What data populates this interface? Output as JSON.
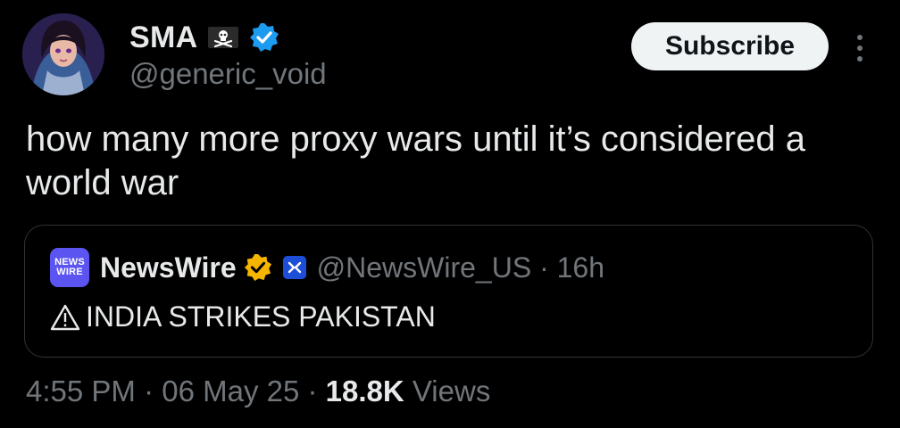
{
  "author": {
    "display_name": "SMA",
    "handle": "@generic_void",
    "avatar_icon": "anime-portrait-avatar",
    "flag_icon": "pirate-flag-icon",
    "badge_icon": "blue-verified-icon"
  },
  "actions": {
    "subscribe_label": "Subscribe",
    "more_icon": "more-options-icon"
  },
  "tweet": {
    "text": "how many more proxy wars until it’s considered a world war"
  },
  "quote": {
    "logo_line1": "NEWS",
    "logo_line2": "WIRE",
    "name": "NewsWire",
    "handle_time": "@NewsWire_US · 16h",
    "text": "INDIA STRIKES PAKISTAN",
    "warning_icon": "warning-triangle-icon",
    "badge_icon": "gold-verified-icon",
    "affiliate_icon": "affiliate-badge-icon"
  },
  "footer": {
    "time": "4:55 PM",
    "sep1": " · ",
    "date": "06 May 25",
    "sep2": " · ",
    "views_count": "18.8K",
    "views_label": " Views"
  },
  "colors": {
    "background": "#000000",
    "text": "#e7e9ea",
    "secondary": "#71767b",
    "verified_blue": "#1d9bf0",
    "verified_gold": "#f7b500",
    "border": "#2f3336"
  }
}
